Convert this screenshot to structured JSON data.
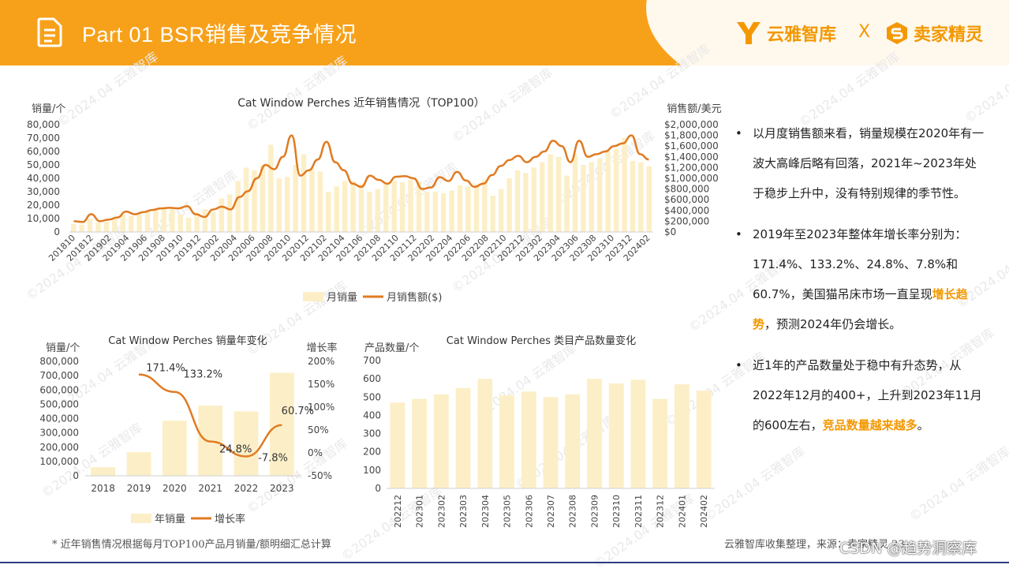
{
  "header": {
    "title": "Part 01  BSR销售及竞争情况",
    "brand_left": "云雅智库",
    "brand_sep": "X",
    "brand_right": "卖家精灵"
  },
  "watermark": "©2024.04 云雅智库",
  "colors": {
    "header": "#f7a11a",
    "bar": "#fcefc7",
    "line": "#e07b22",
    "highlight": "#f39800"
  },
  "bullets": [
    {
      "text": "以月度销售额来看，销量规模在2020年有一波大高峰后略有回落，2021年~2023年处于稳步上升中，没有特别规律的季节性。",
      "highlight": "",
      "after": ""
    },
    {
      "text": "2019年至2023年整体年增长率分别为：171.4%、133.2%、24.8%、7.8%和60.7%，美国猫吊床市场一直呈现",
      "highlight": "增长趋势",
      "after": "，预测2024年仍会增长。"
    },
    {
      "text": "近1年的产品数量处于稳中有升态势，从2022年12月的400+，上升到2023年11月的600左右，",
      "highlight": "竞品数量越来越多",
      "after": "。"
    }
  ],
  "footer": {
    "note": "* 近年销售情况根据每月TOP100产品月销量/额明细汇总计算",
    "source": "云雅智库收集整理，来源：卖家精灵 23",
    "csdn": "CSDN @趋势洞察库"
  },
  "chart_data": [
    {
      "type": "bar+line",
      "title": "Cat Window Perches 近年销售情况（TOP100）",
      "ylabel": "销量/个",
      "y2label": "销售额/美元",
      "ylim": [
        0,
        80000
      ],
      "y2lim": [
        0,
        2000000
      ],
      "yticks": [
        "80,000",
        "70,000",
        "60,000",
        "50,000",
        "40,000",
        "30,000",
        "20,000",
        "10,000",
        "0"
      ],
      "y2ticks": [
        "$2,000,000",
        "$1,800,000",
        "$1,600,000",
        "$1,400,000",
        "$1,200,000",
        "$1,000,000",
        "$800,000",
        "$600,000",
        "$400,000",
        "$200,000",
        "$0"
      ],
      "x_labels": [
        "201810",
        "201812",
        "201902",
        "201904",
        "201906",
        "201908",
        "201910",
        "201912",
        "202002",
        "202004",
        "202006",
        "202008",
        "202010",
        "202012",
        "202102",
        "202104",
        "202106",
        "202108",
        "202110",
        "202112",
        "202202",
        "202204",
        "202206",
        "202208",
        "202210",
        "202212",
        "202302",
        "202304",
        "202306",
        "202308",
        "202310",
        "202312",
        "202402"
      ],
      "series": [
        {
          "name": "月销量",
          "kind": "bar",
          "values": [
            6000,
            5500,
            10000,
            7000,
            7500,
            11000,
            13000,
            12000,
            14500,
            15500,
            17000,
            17500,
            17000,
            13000,
            10500,
            14500,
            17000,
            15000,
            25000,
            28000,
            38000,
            48000,
            46000,
            50000,
            65000,
            40000,
            41000,
            50000,
            58000,
            47000,
            45000,
            30000,
            34000,
            38000,
            38000,
            36000,
            30000,
            32000,
            36000,
            38000,
            37000,
            39000,
            38000,
            30000,
            30000,
            29000,
            31000,
            35000,
            34000,
            36000,
            39000,
            27000,
            32000,
            40000,
            46000,
            44000,
            48000,
            52000,
            58000,
            56000,
            42000,
            58000,
            50000,
            52000,
            55000,
            60000,
            62000,
            70000,
            53000,
            52000,
            49000
          ]
        },
        {
          "name": "月销售额($)",
          "kind": "line",
          "values": [
            200000,
            185000,
            330000,
            200000,
            230000,
            270000,
            380000,
            330000,
            370000,
            410000,
            440000,
            450000,
            440000,
            480000,
            330000,
            280000,
            420000,
            470000,
            420000,
            650000,
            760000,
            1000000,
            1250000,
            1170000,
            1400000,
            1800000,
            1050000,
            1150000,
            1350000,
            1680000,
            1300000,
            1150000,
            900000,
            840000,
            1050000,
            970000,
            900000,
            1030000,
            1040000,
            1000000,
            800000,
            830000,
            1020000,
            950000,
            1120000,
            960000,
            840000,
            900000,
            1060000,
            1230000,
            1340000,
            1420000,
            1300000,
            1400000,
            1500000,
            1700000,
            1600000,
            1300000,
            1700000,
            1400000,
            1450000,
            1500000,
            1600000,
            1650000,
            1800000,
            1450000,
            1350000
          ]
        }
      ],
      "legend": "bottom"
    },
    {
      "type": "bar+line",
      "title": "Cat Window Perches 销量年变化",
      "ylabel": "销量/个",
      "y2label": "增长率",
      "ylim": [
        0,
        800000
      ],
      "y2lim": [
        -50,
        200
      ],
      "yticks": [
        "800,000",
        "700,000",
        "600,000",
        "500,000",
        "400,000",
        "300,000",
        "200,000",
        "100,000",
        "0"
      ],
      "y2ticks": [
        "200%",
        "150%",
        "100%",
        "50%",
        "0%",
        "-50%"
      ],
      "categories": [
        "2018",
        "2019",
        "2020",
        "2021",
        "2022",
        "2023"
      ],
      "series": [
        {
          "name": "年销量",
          "kind": "bar",
          "values": [
            60000,
            165000,
            385000,
            490000,
            450000,
            720000
          ]
        },
        {
          "name": "增长率",
          "kind": "line",
          "values": [
            null,
            171.4,
            133.2,
            24.8,
            -7.8,
            60.7
          ],
          "labels": [
            "",
            "171.4%",
            "133.2%",
            "24.8%",
            "-7.8%",
            "60.7%"
          ]
        }
      ],
      "legend": "bottom"
    },
    {
      "type": "bar",
      "title": "Cat Window Perches 类目产品数量变化",
      "ylabel": "产品数量/个",
      "ylim": [
        0,
        700
      ],
      "yticks": [
        "700",
        "600",
        "500",
        "400",
        "300",
        "200",
        "100",
        "0"
      ],
      "categories": [
        "202212",
        "202301",
        "202302",
        "202303",
        "202304",
        "202305",
        "202306",
        "202307",
        "202308",
        "202309",
        "202310",
        "202311",
        "202312",
        "202401",
        "202402"
      ],
      "values": [
        470,
        490,
        515,
        550,
        600,
        510,
        530,
        500,
        515,
        600,
        575,
        595,
        490,
        570,
        535
      ]
    }
  ]
}
